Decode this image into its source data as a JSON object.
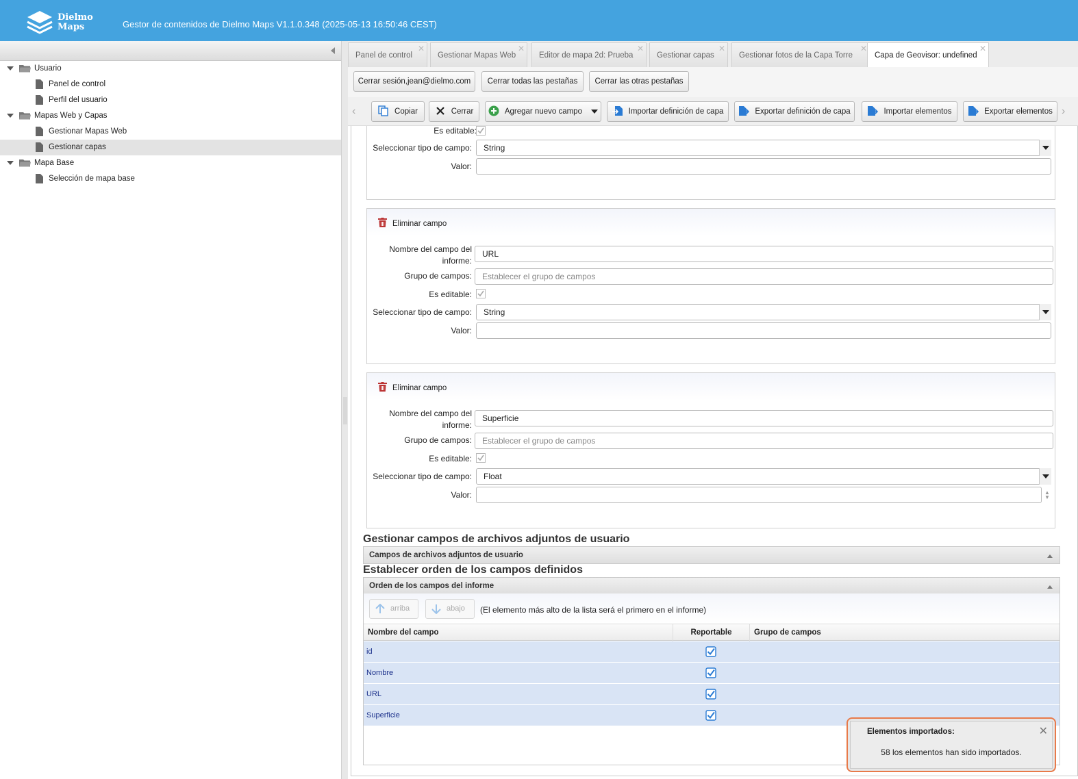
{
  "header": {
    "logo_line1": "Dielmo",
    "logo_line2": "Maps",
    "title": "Gestor de contenidos de Dielmo Maps V1.1.0.348 (2025-05-13 16:50:46 CEST)"
  },
  "sidebar": {
    "groups": [
      {
        "label": "Usuario",
        "items": [
          "Panel de control",
          "Perfil del usuario"
        ]
      },
      {
        "label": "Mapas Web y Capas",
        "items": [
          "Gestionar Mapas Web",
          "Gestionar capas"
        ]
      },
      {
        "label": "Mapa Base",
        "items": [
          "Selección de mapa base"
        ]
      }
    ],
    "selected": "Gestionar capas"
  },
  "tabs": [
    {
      "label": "Panel de control"
    },
    {
      "label": "Gestionar Mapas Web"
    },
    {
      "label": "Editor de mapa 2d: Prueba"
    },
    {
      "label": "Gestionar capas"
    },
    {
      "label": "Gestionar fotos de la Capa Torre"
    },
    {
      "label": "Capa de Geovisor: undefined"
    }
  ],
  "session": {
    "logout": "Cerrar sesión,jean@dielmo.com",
    "close_all": "Cerrar todas las pestañas",
    "close_others": "Cerrar las otras pestañas"
  },
  "toolbar": {
    "copy": "Copiar",
    "close": "Cerrar",
    "add_field": "Agregar nuevo campo",
    "import_def": "Importar definición de capa",
    "export_def": "Exportar definición de capa",
    "import_elements": "Importar elementos",
    "export_elements": "Exportar elementos"
  },
  "labels": {
    "editable": "Es editable:",
    "field_type": "Seleccionar tipo de campo:",
    "value": "Valor:",
    "report_name": "Nombre del campo del informe:",
    "field_group": "Grupo de campos:",
    "delete_field": "Eliminar campo",
    "group_placeholder": "Establecer el grupo de campos"
  },
  "partial_block": {
    "type": "String"
  },
  "fields": [
    {
      "name": "URL",
      "type": "String"
    },
    {
      "name": "Superficie",
      "type": "Float"
    }
  ],
  "attachments": {
    "title": "Gestionar campos de archivos adjuntos de usuario",
    "bar": "Campos de archivos adjuntos de usuario"
  },
  "order": {
    "title": "Establecer orden de los campos definidos",
    "bar": "Orden de los campos del informe",
    "up": "arriba",
    "down": "abajo",
    "hint": "(El elemento más alto de la lista será el primero en el informe)",
    "columns": [
      "Nombre del campo",
      "Reportable",
      "Grupo de campos"
    ],
    "rows": [
      "id",
      "Nombre",
      "URL",
      "Superficie"
    ]
  },
  "toast": {
    "title": "Elementos importados:",
    "message": "58 los elementos han sido importados."
  }
}
